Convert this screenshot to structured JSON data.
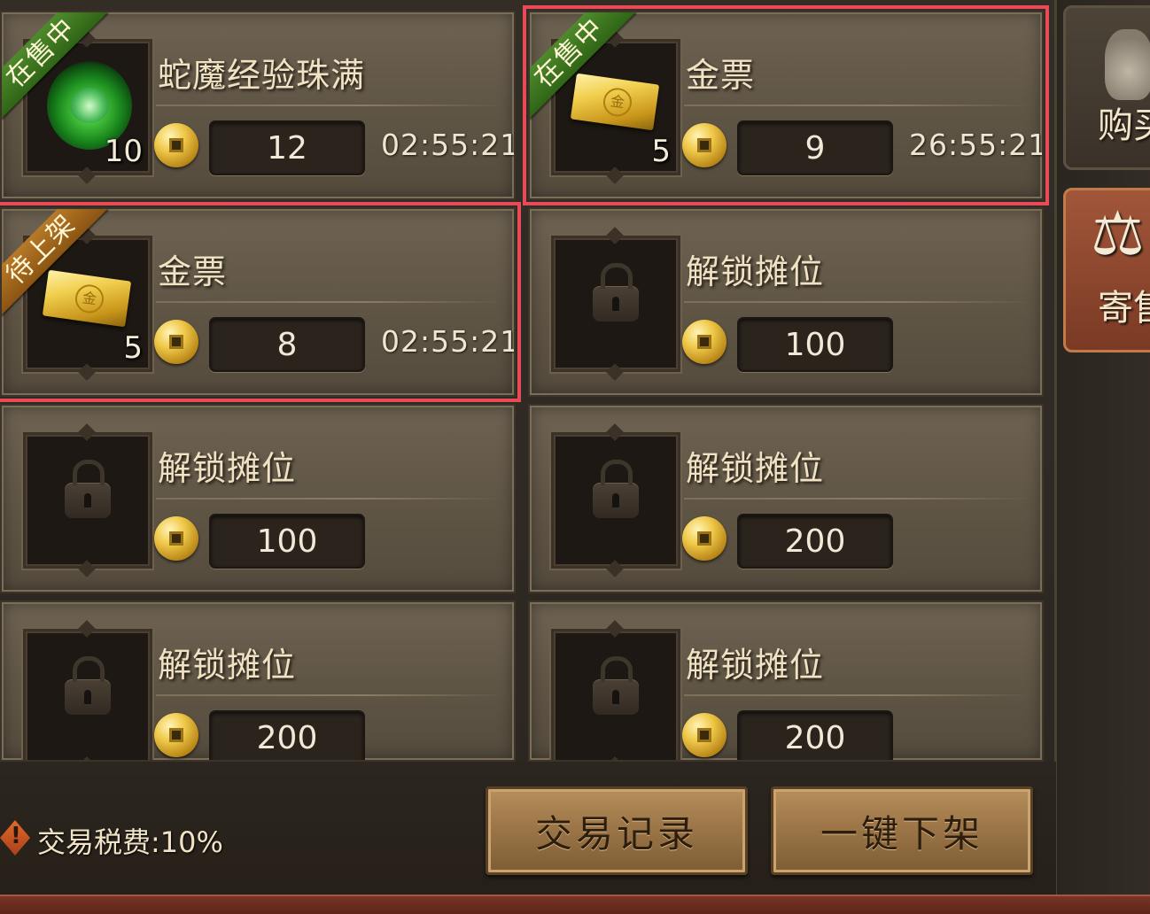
{
  "slots": [
    {
      "name": "蛇魔经验珠满",
      "qty": "10",
      "price": "12",
      "timer": "02:55:21",
      "ribbon": "在售中",
      "ribbon_color": "green",
      "icon": "snake-exp-orb-icon"
    },
    {
      "name": "金票",
      "qty": "5",
      "price": "9",
      "timer": "26:55:21",
      "ribbon": "在售中",
      "ribbon_color": "green",
      "icon": "gold-ticket-icon"
    },
    {
      "name": "金票",
      "qty": "5",
      "price": "8",
      "timer": "02:55:21",
      "ribbon": "待上架",
      "ribbon_color": "orange",
      "icon": "gold-ticket-icon"
    },
    {
      "name": "解锁摊位",
      "price": "100",
      "icon": "lock-icon"
    },
    {
      "name": "解锁摊位",
      "price": "100",
      "icon": "lock-icon"
    },
    {
      "name": "解锁摊位",
      "price": "200",
      "icon": "lock-icon"
    },
    {
      "name": "解锁摊位",
      "price": "200",
      "icon": "lock-icon"
    },
    {
      "name": "解锁摊位",
      "price": "200",
      "icon": "lock-icon"
    }
  ],
  "side_tabs": {
    "buy_label": "购买",
    "consign_label": "寄售"
  },
  "footer": {
    "tax_text": "交易税费:10%",
    "log_button": "交易记录",
    "unlist_all_button": "一键下架"
  },
  "colors": {
    "highlight": "#e94a55",
    "ribbon_green": "#3f7a22",
    "ribbon_orange": "#a86a20"
  }
}
